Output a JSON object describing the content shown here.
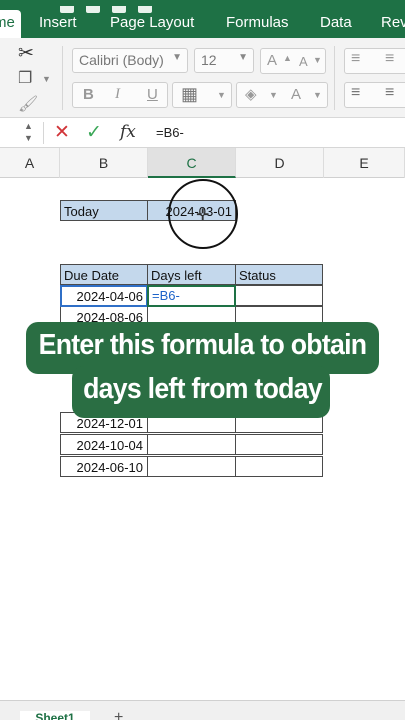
{
  "ribbon": {
    "tabs": [
      "me",
      "Insert",
      "Page Layout",
      "Formulas",
      "Data",
      "Rev"
    ]
  },
  "toolbar": {
    "font_name": "Calibri (Body)",
    "font_size": "12",
    "bold": "B",
    "italic": "I",
    "underline": "U",
    "grow_font": "A",
    "shrink_font": "A",
    "font_color": "A"
  },
  "formula_bar": {
    "cancel": "✕",
    "enter": "✓",
    "fx": "fx",
    "formula": "=B6-"
  },
  "columns": [
    "A",
    "B",
    "C",
    "D",
    "E"
  ],
  "cells": {
    "today_label": "Today",
    "today_value": "2024-03-01",
    "headers": [
      "Due Date",
      "Days left",
      "Status"
    ],
    "due_dates": [
      "2024-04-06",
      "2024-08-06",
      "",
      "",
      "2024-12-01",
      "2024-10-04",
      "2024-06-10"
    ],
    "editing_value": "=B6-"
  },
  "caption": {
    "line1": "Enter this formula to obtain",
    "line2": "days left from today"
  },
  "sheets": {
    "active": "Sheet1",
    "add": "+"
  },
  "colors": {
    "excel_green": "#1e7145",
    "header_fill": "#c4d8ec",
    "caption_bg": "#2a6e43"
  }
}
